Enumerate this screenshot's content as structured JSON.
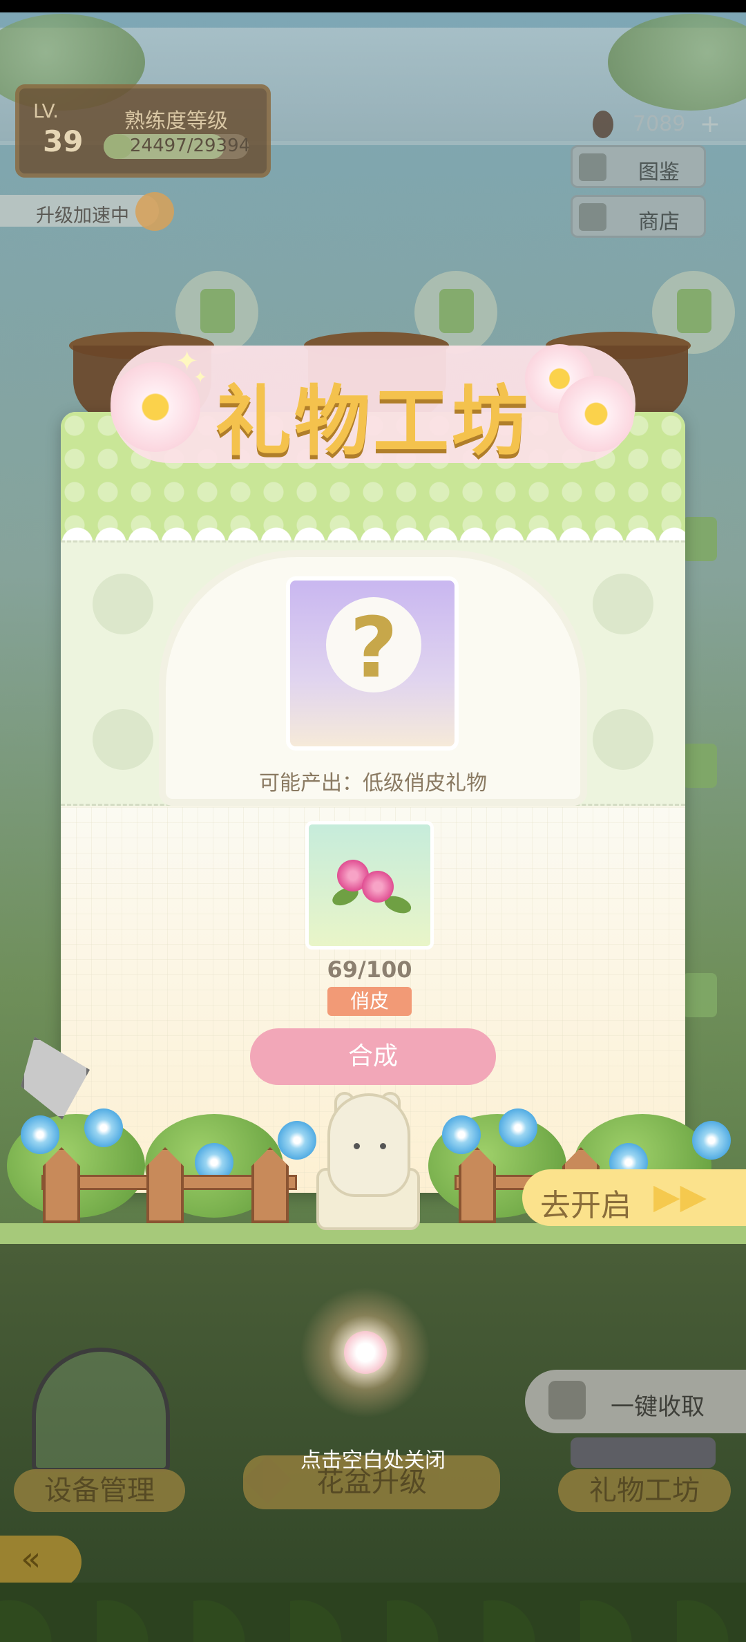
{
  "hud": {
    "level_label": "LV.",
    "level_value": "39",
    "proficiency_title": "熟练度等级",
    "proficiency_progress": "24497/29394",
    "proficiency_fraction": 0.833,
    "boost_label": "升级加速中",
    "currency_value": "7089",
    "plus_label": "+",
    "catalog_label": "图鉴",
    "shop_label": "商店"
  },
  "modal": {
    "title": "礼物工坊",
    "possible_output": "可能产出：低级俏皮礼物",
    "mystery_mark": "?",
    "material_count": "69/100",
    "material_tag": "俏皮",
    "synthesize_label": "合成"
  },
  "garden": {
    "goto_open_label": "去开启",
    "goto_arrows": "▶▶"
  },
  "overlay": {
    "close_hint": "点击空白处关闭"
  },
  "dock": {
    "device_manage_label": "设备管理",
    "pot_upgrade_label": "花盆升级",
    "gift_workshop_label": "礼物工坊",
    "collect_all_label": "一键收取",
    "back_icon": "«"
  },
  "colors": {
    "accent_green": "#c9e697",
    "title_gold": "#f4c24d",
    "synth_pink": "#f2a7b8",
    "tag_orange": "#f29a76",
    "goto_yellow": "#fbe28c"
  }
}
